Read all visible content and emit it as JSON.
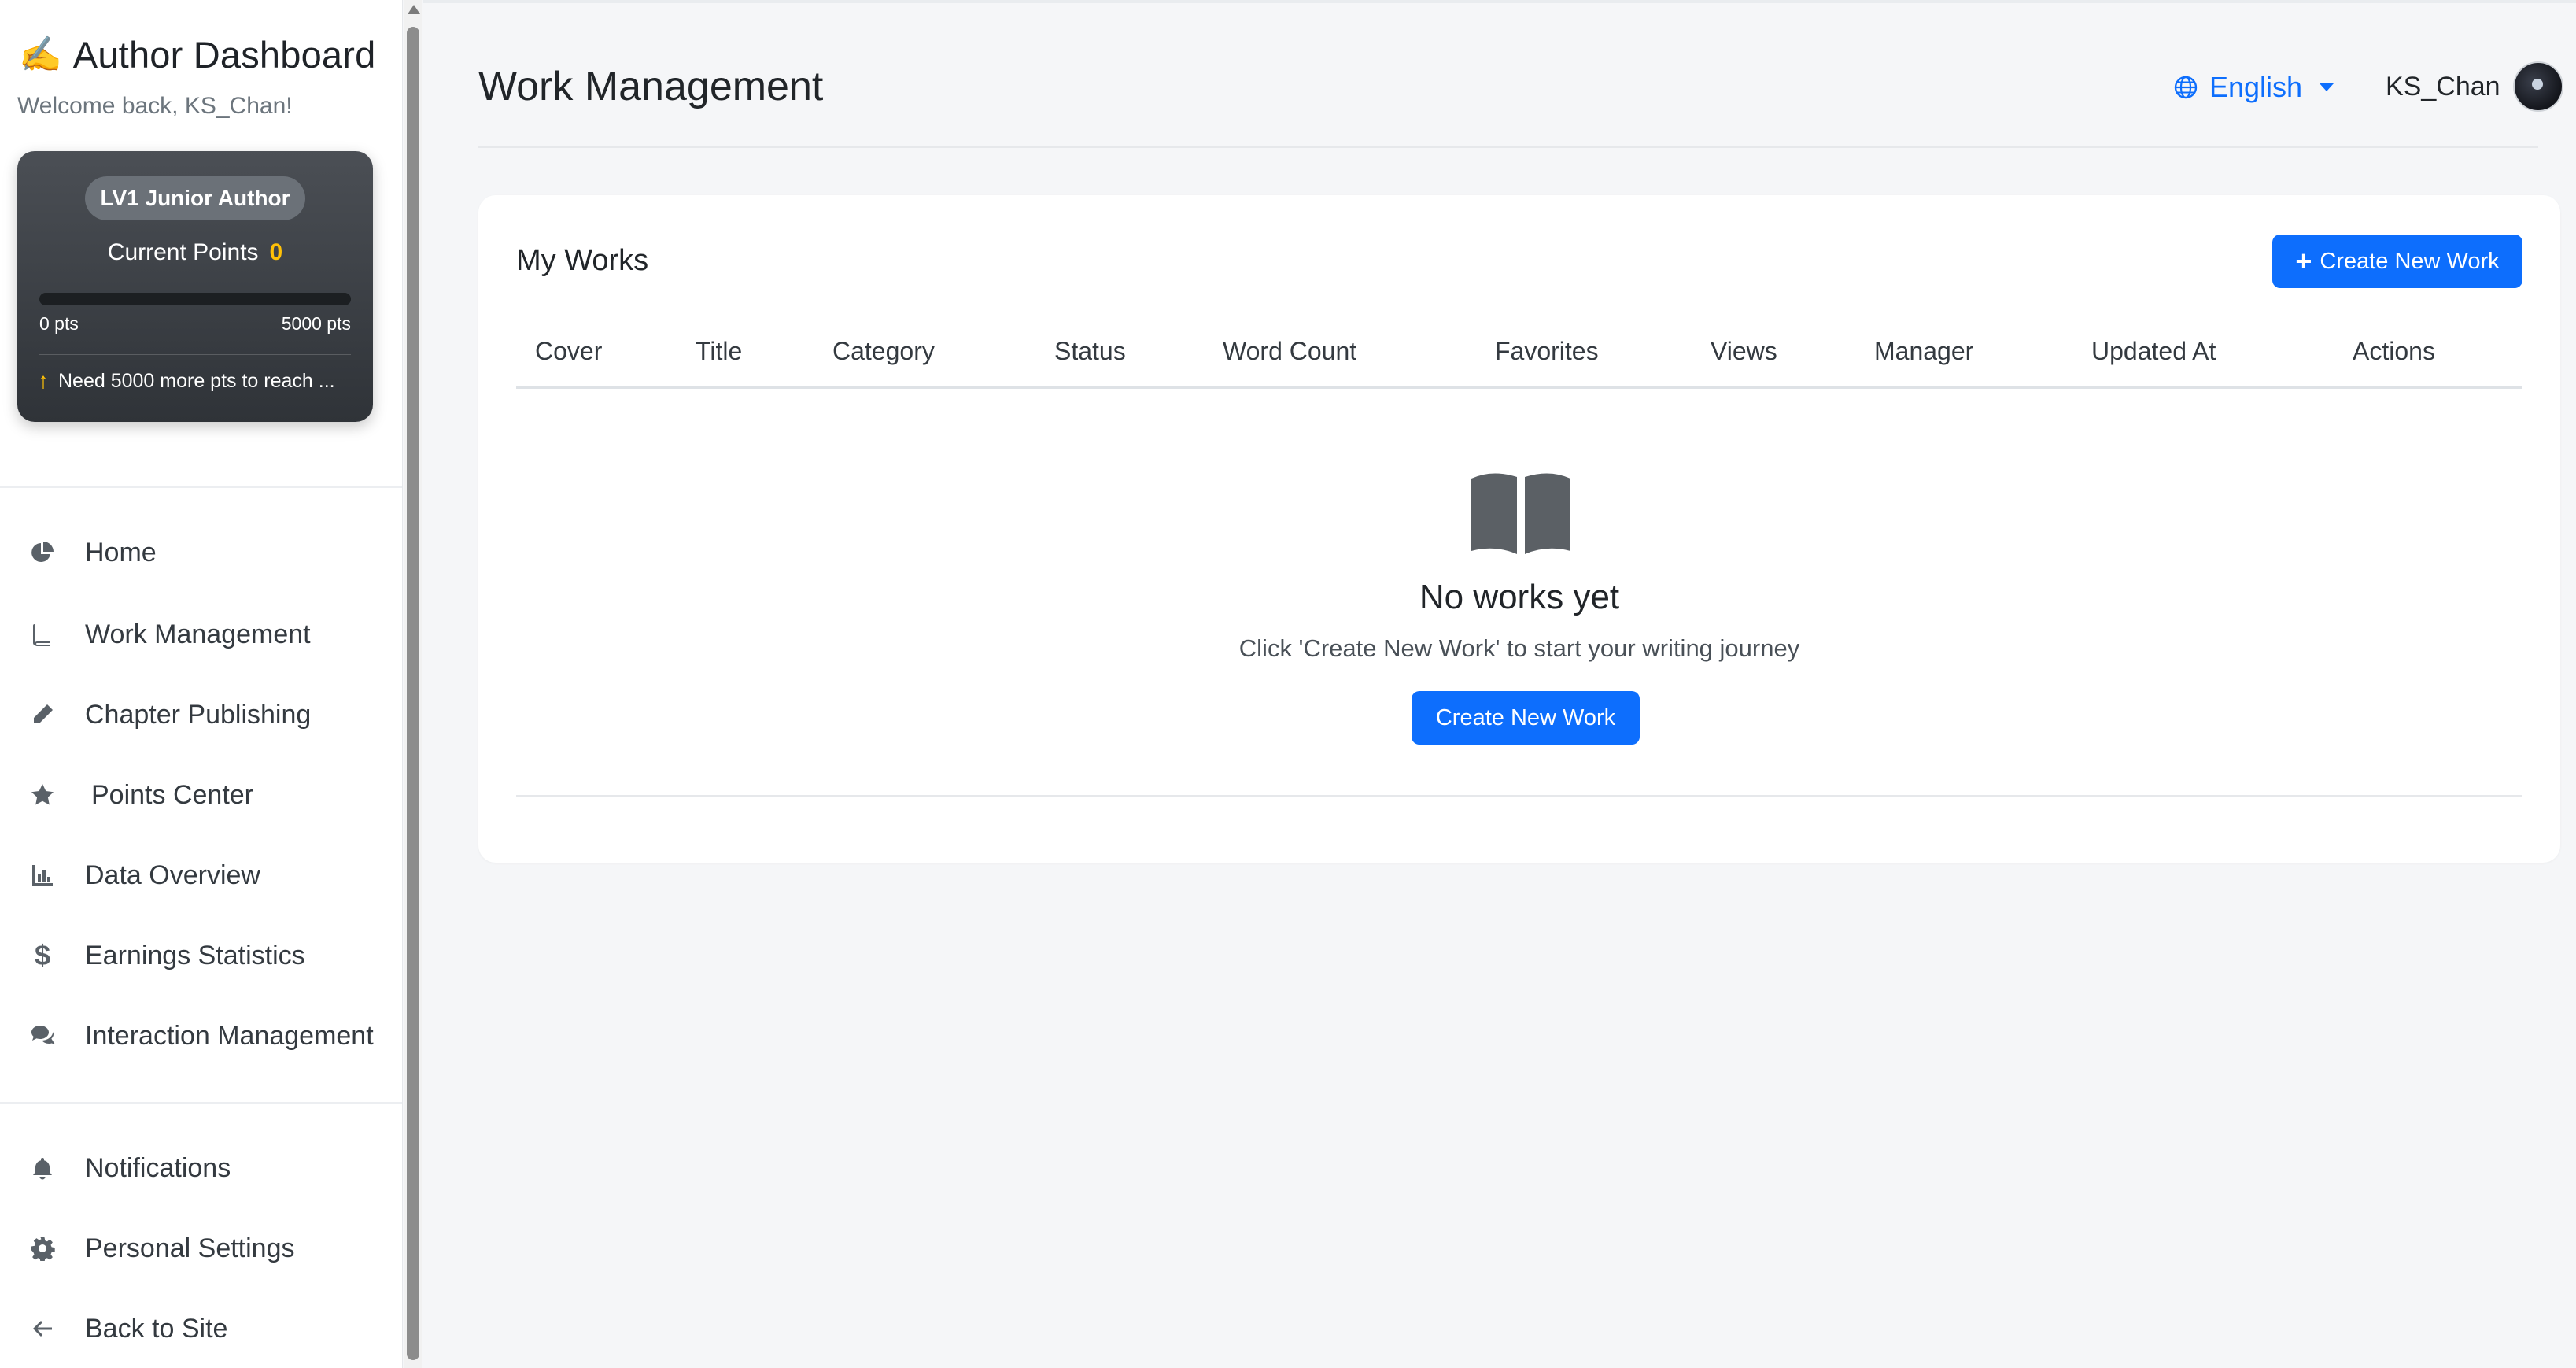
{
  "sidebar": {
    "brand_emoji": "✍️",
    "brand_title": "Author Dashboard",
    "welcome": "Welcome back, KS_Chan!",
    "level_card": {
      "badge": "LV1 Junior Author",
      "points_label": "Current Points",
      "points_value": "0",
      "progress_percent": 0,
      "progress_min": "0 pts",
      "progress_max": "5000 pts",
      "next_level_text": "Need 5000 more pts to reach ..."
    },
    "nav_primary": [
      {
        "label": "Home",
        "icon": "chart-pie-icon"
      },
      {
        "label": "Work Management",
        "icon": "book-icon"
      },
      {
        "label": "Chapter Publishing",
        "icon": "pencil-icon"
      },
      {
        "label": "Points Center",
        "icon": "star-icon"
      },
      {
        "label": "Data Overview",
        "icon": "bar-chart-icon"
      },
      {
        "label": "Earnings Statistics",
        "icon": "dollar-icon"
      },
      {
        "label": "Interaction Management",
        "icon": "comments-icon"
      }
    ],
    "nav_secondary": [
      {
        "label": "Notifications",
        "icon": "bell-icon"
      },
      {
        "label": "Personal Settings",
        "icon": "gear-icon"
      },
      {
        "label": "Back to Site",
        "icon": "arrow-left-icon"
      }
    ]
  },
  "header": {
    "title": "Work Management",
    "language": "English",
    "username": "KS_Chan"
  },
  "works": {
    "title": "My Works",
    "create_button": "Create New Work",
    "columns": [
      "Cover",
      "Title",
      "Category",
      "Status",
      "Word Count",
      "Favorites",
      "Views",
      "Manager",
      "Updated At",
      "Actions"
    ],
    "empty_title": "No works yet",
    "empty_subtitle": "Click 'Create New Work' to start your writing journey",
    "empty_button": "Create New Work"
  },
  "colors": {
    "primary": "#0d6efd",
    "accent_points": "#ffc107",
    "card_dark": "#3a3e44"
  }
}
